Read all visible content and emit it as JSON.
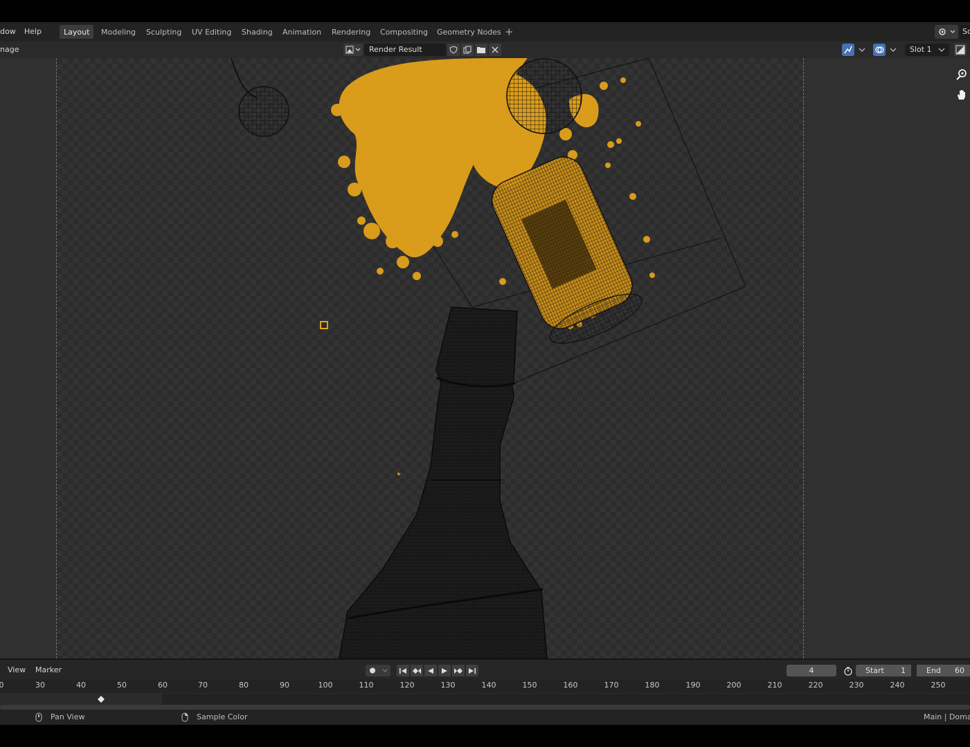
{
  "menu": {
    "window_label": "dow",
    "help_label": "Help"
  },
  "workspaces": [
    {
      "label": "Layout",
      "active": true
    },
    {
      "label": "Modeling"
    },
    {
      "label": "Sculpting"
    },
    {
      "label": "UV Editing"
    },
    {
      "label": "Shading"
    },
    {
      "label": "Animation"
    },
    {
      "label": "Rendering"
    },
    {
      "label": "Compositing"
    },
    {
      "label": "Geometry Nodes"
    }
  ],
  "add_workspace_icon": "plus-icon",
  "scene_label": "Sc",
  "editor_header": {
    "image_menu_label": "nage",
    "image_name": "Render Result",
    "slot_label": "Slot 1"
  },
  "timeline": {
    "view_label": "View",
    "marker_label": "Marker",
    "current_frame": "4",
    "start_label": "Start",
    "start_value": "1",
    "end_label": "End",
    "end_value": "60",
    "ruler_ticks": [
      "0",
      "30",
      "40",
      "50",
      "60",
      "70",
      "80",
      "90",
      "100",
      "110",
      "120",
      "130",
      "140",
      "150",
      "160",
      "170",
      "180",
      "190",
      "200",
      "210",
      "220",
      "230",
      "240",
      "250"
    ]
  },
  "status_bar": {
    "left_hint": "Pan View",
    "middle_hint": "Sample Color",
    "right_info": "Main | Domai"
  },
  "colors": {
    "accent_blue": "#4772b3",
    "liquid_orange": "#e3a21a",
    "wireframe": "#0d0d0d"
  }
}
